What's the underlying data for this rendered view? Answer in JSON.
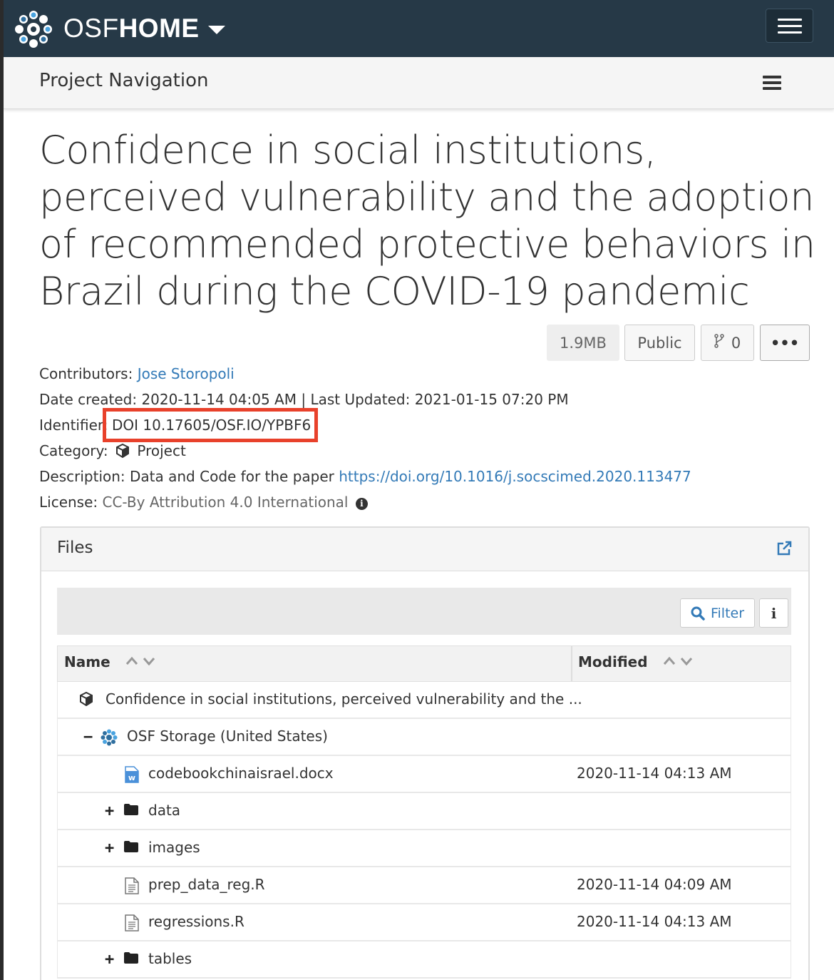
{
  "navbar": {
    "brand_osf": "OSF",
    "brand_home": "HOME",
    "logo_icon": "osf-logo-icon",
    "menu_icon": "hamburger-icon"
  },
  "project_nav": {
    "title": "Project Navigation"
  },
  "project": {
    "title": "Confidence in social institutions, perceived vulnerability and the adoption of recommended protective behaviors in Brazil during the COVID-19 pandemic",
    "size": "1.9MB",
    "visibility": "Public",
    "forks": "0",
    "more_label": "•••"
  },
  "metadata": {
    "contributors_label": "Contributors:",
    "contributors_value": "Jose Storopoli",
    "date_label": "Date created:",
    "date_created": "2020-11-14 04:05 AM",
    "separator": "|",
    "updated_label": "Last Updated:",
    "last_updated": "2021-01-15 07:20 PM",
    "identifier_label": "Identifier:",
    "identifier_value": "DOI 10.17605/OSF.IO/YPBF6",
    "category_label": "Category:",
    "category_value": "Project",
    "description_label": "Description:",
    "description_text": "Data and Code for the paper",
    "description_link": "https://doi.org/10.1016/j.socscimed.2020.113477",
    "license_label": "License:",
    "license_value": "CC-By Attribution 4.0 International"
  },
  "annotation": {
    "highlight_color": "#e8412b"
  },
  "files": {
    "panel_title": "Files",
    "filter_label": "Filter",
    "info_label": "i",
    "columns": {
      "name": "Name",
      "modified": "Modified"
    },
    "rows": [
      {
        "name": "Confidence in social institutions, perceived vulnerability and the ...",
        "modified": "",
        "kind": "project"
      },
      {
        "name": "OSF Storage (United States)",
        "modified": "",
        "kind": "storage",
        "toggle": "−"
      },
      {
        "name": "codebookchinaisrael.docx",
        "modified": "2020-11-14 04:13 AM",
        "kind": "docx"
      },
      {
        "name": "data",
        "modified": "",
        "kind": "folder",
        "toggle": "+"
      },
      {
        "name": "images",
        "modified": "",
        "kind": "folder",
        "toggle": "+"
      },
      {
        "name": "prep_data_reg.R",
        "modified": "2020-11-14 04:09 AM",
        "kind": "file"
      },
      {
        "name": "regressions.R",
        "modified": "2020-11-14 04:13 AM",
        "kind": "file"
      },
      {
        "name": "tables",
        "modified": "",
        "kind": "folder",
        "toggle": "+"
      }
    ]
  },
  "colors": {
    "navbar_bg": "#263947",
    "link": "#337ab7",
    "highlight": "#e8412b"
  }
}
